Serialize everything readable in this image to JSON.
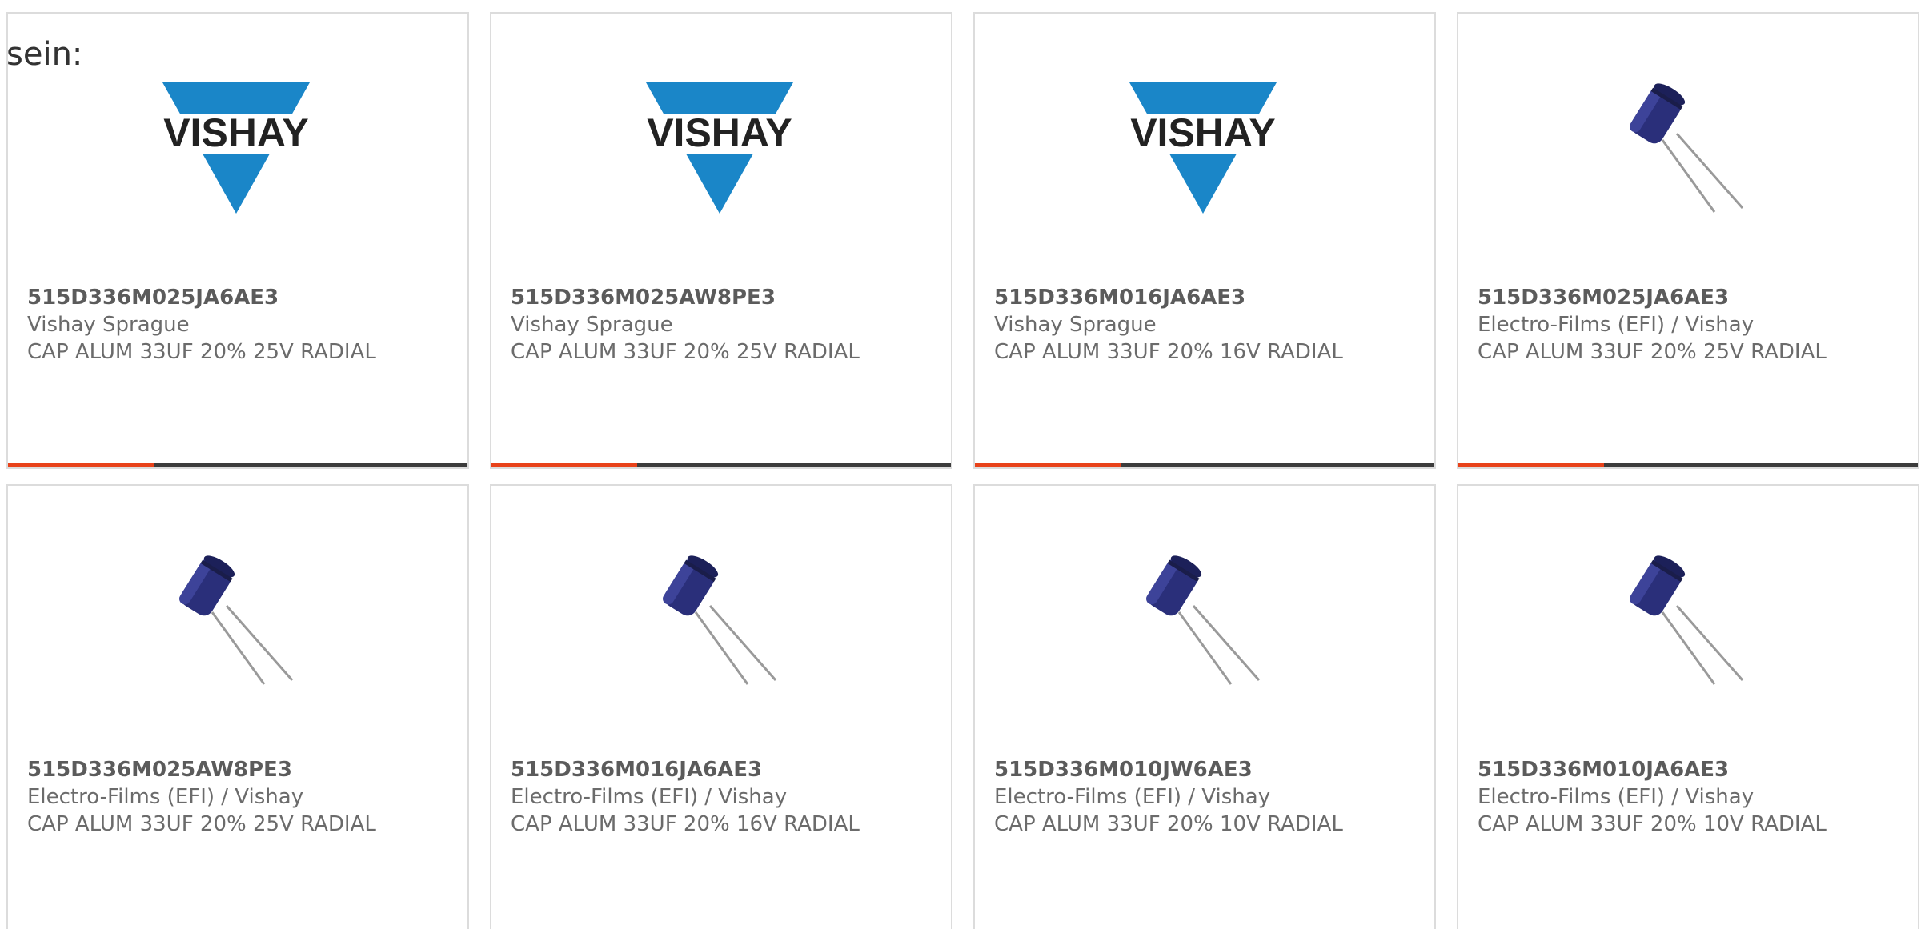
{
  "intro": {
    "text": "sein:"
  },
  "colors": {
    "accent": "#e8421a",
    "bar_dark": "#3c3c3c",
    "card_border": "#dcdcdc",
    "vishay_blue": "#1a86c8",
    "capacitor_blue": "#2a2f7a"
  },
  "products": [
    {
      "part_number": "515D336M025JA6AE3",
      "manufacturer": "Vishay Sprague",
      "description": "CAP ALUM 33UF 20% 25V RADIAL",
      "image": "vishay-logo"
    },
    {
      "part_number": "515D336M025AW8PE3",
      "manufacturer": "Vishay Sprague",
      "description": "CAP ALUM 33UF 20% 25V RADIAL",
      "image": "vishay-logo"
    },
    {
      "part_number": "515D336M016JA6AE3",
      "manufacturer": "Vishay Sprague",
      "description": "CAP ALUM 33UF 20% 16V RADIAL",
      "image": "vishay-logo"
    },
    {
      "part_number": "515D336M025JA6AE3",
      "manufacturer": "Electro-Films (EFI) / Vishay",
      "description": "CAP ALUM 33UF 20% 25V RADIAL",
      "image": "capacitor-photo"
    },
    {
      "part_number": "515D336M025AW8PE3",
      "manufacturer": "Electro-Films (EFI) / Vishay",
      "description": "CAP ALUM 33UF 20% 25V RADIAL",
      "image": "capacitor-photo"
    },
    {
      "part_number": "515D336M016JA6AE3",
      "manufacturer": "Electro-Films (EFI) / Vishay",
      "description": "CAP ALUM 33UF 20% 16V RADIAL",
      "image": "capacitor-photo"
    },
    {
      "part_number": "515D336M010JW6AE3",
      "manufacturer": "Electro-Films (EFI) / Vishay",
      "description": "CAP ALUM 33UF 20% 10V RADIAL",
      "image": "capacitor-photo"
    },
    {
      "part_number": "515D336M010JA6AE3",
      "manufacturer": "Electro-Films (EFI) / Vishay",
      "description": "CAP ALUM 33UF 20% 10V RADIAL",
      "image": "capacitor-photo"
    }
  ],
  "vishay_logo_text": "VISHAY"
}
